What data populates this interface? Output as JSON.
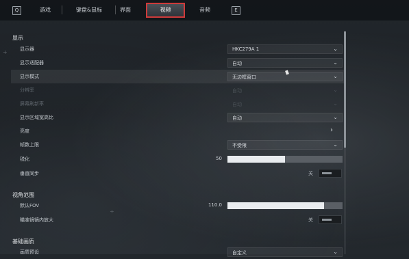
{
  "tabs": {
    "left_key": "Q",
    "right_key": "E",
    "items": [
      {
        "label": "游戏"
      },
      {
        "label": "键盘&鼠标"
      },
      {
        "label": "界面"
      },
      {
        "label": "视频"
      },
      {
        "label": "音频"
      }
    ],
    "active_index": 3,
    "active_color": "#cf3b3b"
  },
  "sections": {
    "display": {
      "title": "显示",
      "monitor": {
        "label": "显示器",
        "value": "HKC279A 1"
      },
      "adapter": {
        "label": "显示适配器",
        "value": "自动"
      },
      "mode": {
        "label": "显示模式",
        "value": "无边框窗口"
      },
      "resolution": {
        "label": "分辨率",
        "value": "自动"
      },
      "refresh": {
        "label": "屏幕刷新率",
        "value": "自动"
      },
      "aspect": {
        "label": "显示区域宽高比",
        "value": "自动"
      },
      "brightness": {
        "label": "亮度"
      },
      "fps_cap": {
        "label": "帧数上限",
        "value": "不受限"
      },
      "sharpen": {
        "label": "锐化",
        "value": "50",
        "fraction": 0.5
      },
      "vsync": {
        "label": "垂直同步",
        "state": "关"
      }
    },
    "fov": {
      "title": "视角范围",
      "default_fov": {
        "label": "默认FOV",
        "value": "110.0",
        "fraction": 0.84
      },
      "scope_zoom": {
        "label": "瞄准镜镜内放大",
        "state": "关"
      }
    },
    "basic": {
      "title": "基础画质",
      "preset": {
        "label": "画质预设",
        "value": "自定义"
      }
    }
  },
  "icons": {
    "dropdown": "chevron-down-icon",
    "submenu": "chevron-right-icon"
  }
}
